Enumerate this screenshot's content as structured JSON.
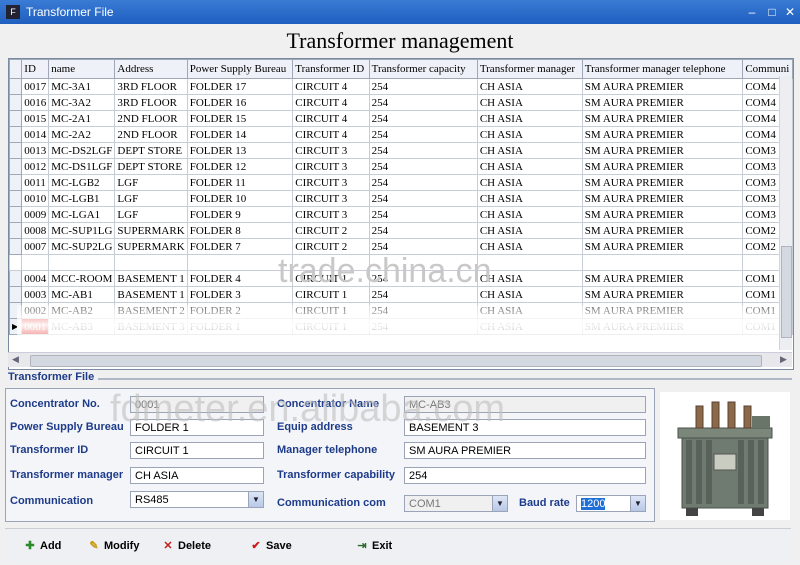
{
  "window": {
    "title": "Transformer File",
    "app_icon": "app-icon",
    "minimize": "–",
    "maximize": "□",
    "close": "✕"
  },
  "main_title": "Transformer management",
  "grid": {
    "columns": [
      "ID",
      "name",
      "Address",
      "Power Supply Bureau",
      "Transformer ID",
      "Transformer capacity",
      "Transformer manager",
      "Transformer manager  telephone",
      "Communi"
    ],
    "rows_top": [
      [
        "0017",
        "MC-3A1",
        "3RD FLOOR",
        "FOLDER 17",
        "CIRCUIT 4",
        "254",
        "CH ASIA",
        "SM AURA PREMIER",
        "COM4"
      ],
      [
        "0016",
        "MC-3A2",
        "3RD FLOOR",
        "FOLDER 16",
        "CIRCUIT 4",
        "254",
        "CH ASIA",
        "SM AURA PREMIER",
        "COM4"
      ],
      [
        "0015",
        "MC-2A1",
        "2ND FLOOR",
        "FOLDER 15",
        "CIRCUIT 4",
        "254",
        "CH ASIA",
        "SM AURA PREMIER",
        "COM4"
      ],
      [
        "0014",
        "MC-2A2",
        "2ND FLOOR",
        "FOLDER 14",
        "CIRCUIT 4",
        "254",
        "CH ASIA",
        "SM AURA PREMIER",
        "COM4"
      ],
      [
        "0013",
        "MC-DS2LGF",
        "DEPT STORE",
        "FOLDER 13",
        "CIRCUIT 3",
        "254",
        "CH ASIA",
        "SM AURA PREMIER",
        "COM3"
      ],
      [
        "0012",
        "MC-DS1LGF",
        "DEPT STORE",
        "FOLDER 12",
        "CIRCUIT 3",
        "254",
        "CH ASIA",
        "SM AURA PREMIER",
        "COM3"
      ],
      [
        "0011",
        "MC-LGB2",
        "LGF",
        "FOLDER 11",
        "CIRCUIT 3",
        "254",
        "CH ASIA",
        "SM AURA PREMIER",
        "COM3"
      ],
      [
        "0010",
        "MC-LGB1",
        "LGF",
        "FOLDER 10",
        "CIRCUIT 3",
        "254",
        "CH ASIA",
        "SM AURA PREMIER",
        "COM3"
      ],
      [
        "0009",
        "MC-LGA1",
        "LGF",
        "FOLDER 9",
        "CIRCUIT 3",
        "254",
        "CH ASIA",
        "SM AURA PREMIER",
        "COM3"
      ],
      [
        "0008",
        "MC-SUP1LG",
        "SUPERMARK",
        "FOLDER 8",
        "CIRCUIT 2",
        "254",
        "CH ASIA",
        "SM AURA PREMIER",
        "COM2"
      ],
      [
        "0007",
        "MC-SUP2LG",
        "SUPERMARK",
        "FOLDER 7",
        "CIRCUIT 2",
        "254",
        "CH ASIA",
        "SM AURA PREMIER",
        "COM2"
      ]
    ],
    "rows_bottom": [
      [
        "0004",
        "MCC-ROOM",
        "BASEMENT 1",
        "FOLDER 4",
        "CIRCUIT 1",
        "254",
        "CH ASIA",
        "SM AURA PREMIER",
        "COM1"
      ],
      [
        "0003",
        "MC-AB1",
        "BASEMENT 1",
        "FOLDER 3",
        "CIRCUIT 1",
        "254",
        "CH ASIA",
        "SM AURA PREMIER",
        "COM1"
      ],
      [
        "0002",
        "MC-AB2",
        "BASEMENT 2",
        "FOLDER 2",
        "CIRCUIT 1",
        "254",
        "CH ASIA",
        "SM AURA PREMIER",
        "COM1"
      ],
      [
        "0001",
        "MC-AB3",
        "BASEMENT 3",
        "FOLDER 1",
        "CIRCUIT 1",
        "254",
        "CH ASIA",
        "SM AURA PREMIER",
        "COM1"
      ]
    ],
    "selected_id": "0001",
    "indicator": "▶"
  },
  "form": {
    "section_title": "Transformer File",
    "concentrator_no_label": "Concentrator No.",
    "concentrator_no_value": "0001",
    "concentrator_name_label": "Concentrator Name",
    "concentrator_name_value": "MC-AB3",
    "psb_label": "Power Supply Bureau",
    "psb_value": "FOLDER 1",
    "equip_address_label": "Equip address",
    "equip_address_value": "BASEMENT 3",
    "transformer_id_label": "Transformer ID",
    "transformer_id_value": "CIRCUIT 1",
    "manager_tel_label": "Manager telephone",
    "manager_tel_value": "SM AURA PREMIER",
    "manager_label": "Transformer manager",
    "manager_value": "CH ASIA",
    "capability_label": "Transformer  capability",
    "capability_value": "254",
    "communication_label": "Communication",
    "communication_value": "RS485",
    "com_label": "Communication  com",
    "com_value": "COM1",
    "baud_label": "Baud rate",
    "baud_value": "1200"
  },
  "buttons": {
    "add": "Add",
    "modify": "Modify",
    "delete": "Delete",
    "save": "Save",
    "exit": "Exit"
  },
  "watermarks": {
    "a": "trade.china.cn",
    "b": "fdmeter.en.alibaba.com"
  },
  "colors": {
    "titlebar": "#1f5fbf",
    "label": "#1d3b8a",
    "selected": "#e00000",
    "baud_highlight": "#1f6fd8"
  }
}
